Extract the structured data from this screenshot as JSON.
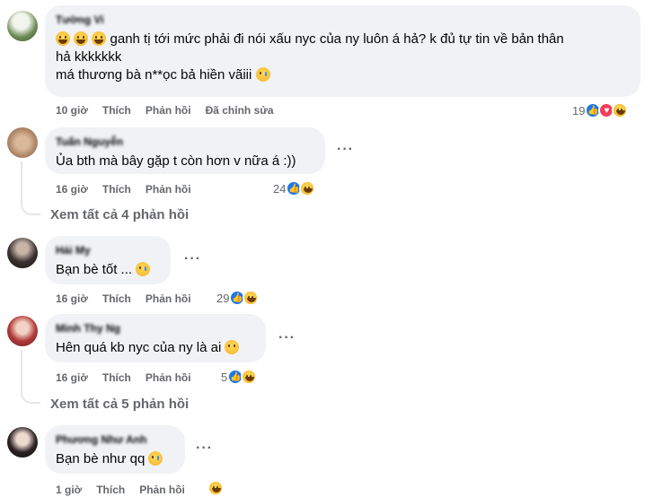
{
  "comments": [
    {
      "author": "Tường Vi",
      "text_line1": "ganh tị tới mức phải đi nói xấu nyc của ny luôn á hả? k đủ tự tin về bản thân",
      "text_line2": "hả kkkkkkk",
      "text_line3": "má thương bà n**ọc bả hiền vãiii",
      "time": "10 giờ",
      "like_label": "Thích",
      "reply_label": "Phản hồi",
      "edited_label": "Đã chỉnh sửa",
      "reaction_count": "19"
    },
    {
      "author": "Tuấn Nguyễn",
      "text": "Ủa bth mà bây gặp t còn hơn v nữa á :))",
      "time": "16 giờ",
      "like_label": "Thích",
      "reply_label": "Phản hồi",
      "reaction_count": "24"
    },
    {
      "author": "Hải My",
      "text": "Bạn bè tốt ...",
      "time": "16 giờ",
      "like_label": "Thích",
      "reply_label": "Phản hồi",
      "reaction_count": "29"
    },
    {
      "author": "Minh Thy Ng",
      "text": "Hên quá kb nyc của ny là ai",
      "time": "16 giờ",
      "like_label": "Thích",
      "reply_label": "Phản hồi",
      "reaction_count": "5"
    },
    {
      "author": "Phương Như Anh",
      "text": "Bạn bè như qq",
      "time": "1 giờ",
      "like_label": "Thích",
      "reply_label": "Phản hồi"
    }
  ],
  "view_replies_1": "Xem tất cả 4 phản hồi",
  "view_replies_2": "Xem tất cả 5 phản hồi",
  "more_glyph": "···",
  "icons": [
    "like-icon",
    "love-icon",
    "haha-icon",
    "emoji-icon"
  ],
  "colors": {
    "like": "#1877f2",
    "love": "#f33e58",
    "haha": "#f7b125",
    "bubble": "#f0f2f5",
    "meta": "#65676b"
  }
}
